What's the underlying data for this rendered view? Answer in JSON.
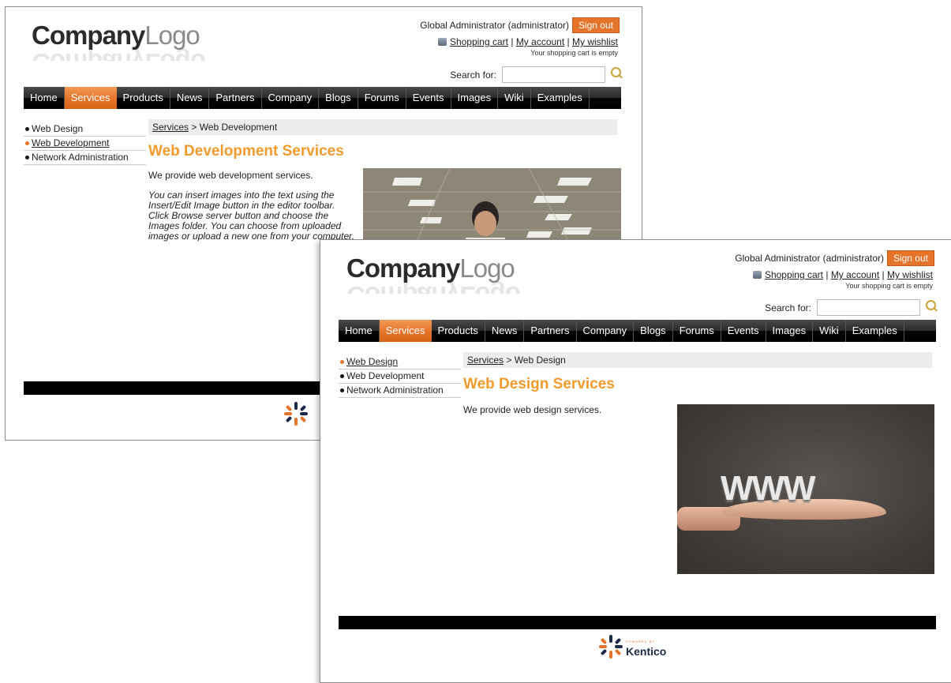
{
  "logo": {
    "company": "Company",
    "logo": "Logo"
  },
  "header": {
    "user": "Global Administrator (administrator)",
    "sign_out": "Sign out",
    "shopping_cart": "Shopping cart",
    "separator": "|",
    "my_account": "My account",
    "my_wishlist": "My wishlist",
    "cart_status": "Your shopping cart is empty",
    "search_label": "Search for:",
    "search_value": ""
  },
  "nav": [
    "Home",
    "Services",
    "Products",
    "News",
    "Partners",
    "Company",
    "Blogs",
    "Forums",
    "Events",
    "Images",
    "Wiki",
    "Examples"
  ],
  "sidebar": [
    "Web Design",
    "Web Development",
    "Network Administration"
  ],
  "page_back": {
    "breadcrumb_link": "Services",
    "breadcrumb_current": " > Web Development",
    "title": "Web Development Services",
    "intro": "We provide web development services.",
    "body": "You can insert images into the text using the Insert/Edit Image button in the editor toolbar. Click Browse server button and choose the Images folder. You can choose from uploaded images or upload a new one from your computer."
  },
  "page_front": {
    "breadcrumb_link": "Services",
    "breadcrumb_current": " > Web Design",
    "title": "Web Design Services",
    "intro": "We provide web design services.",
    "image_text": "WWW"
  },
  "footer": {
    "powered_by": "POWERED BY",
    "brand": "Kentico"
  },
  "colors": {
    "accent": "#e4742a",
    "heading": "#f39a2c",
    "nav_bg": "#000000"
  }
}
